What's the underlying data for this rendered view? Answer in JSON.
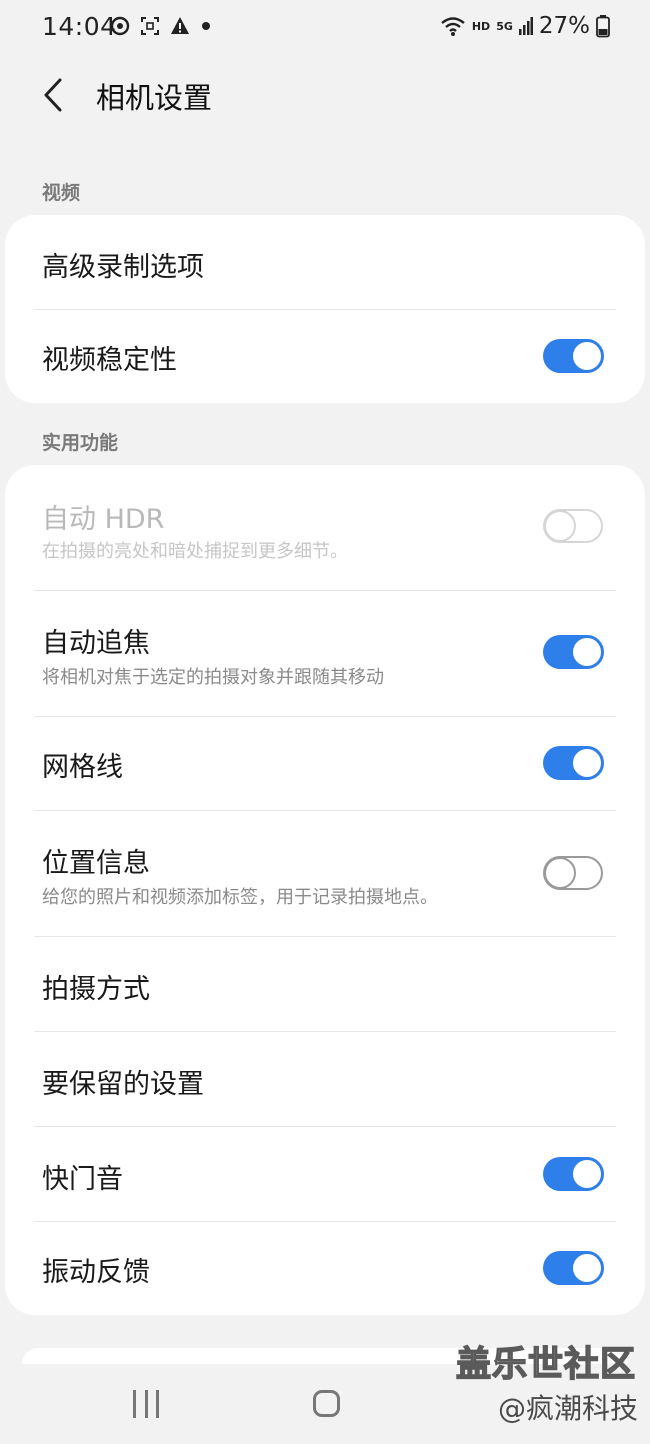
{
  "status_bar": {
    "time": "14:04",
    "hd": "HD",
    "network": "5G",
    "battery": "27%",
    "icons_left": [
      "sync-icon",
      "screenshot-icon",
      "warning-icon",
      "dot-icon"
    ],
    "icons_right": [
      "wifi-icon",
      "signal-icon",
      "battery-icon"
    ]
  },
  "header": {
    "title": "相机设置"
  },
  "sections": {
    "video": {
      "label": "视频",
      "items": {
        "advanced": {
          "title": "高级录制选项"
        },
        "stabilization": {
          "title": "视频稳定性",
          "toggle": "on"
        }
      }
    },
    "utility": {
      "label": "实用功能",
      "items": {
        "auto_hdr": {
          "title": "自动 HDR",
          "subtitle": "在拍摄的亮处和暗处捕捉到更多细节。",
          "toggle": "off",
          "disabled": true
        },
        "tracking_af": {
          "title": "自动追焦",
          "subtitle": "将相机对焦于选定的拍摄对象并跟随其移动",
          "toggle": "on"
        },
        "grid_lines": {
          "title": "网格线",
          "toggle": "on"
        },
        "location_tags": {
          "title": "位置信息",
          "subtitle": "给您的照片和视频添加标签，用于记录拍摄地点。",
          "toggle": "off"
        },
        "shooting_methods": {
          "title": "拍摄方式"
        },
        "settings_to_keep": {
          "title": "要保留的设置"
        },
        "shutter_sound": {
          "title": "快门音",
          "toggle": "on"
        },
        "vibration_feedback": {
          "title": "振动反馈",
          "toggle": "on"
        }
      }
    }
  },
  "watermark": {
    "line1": "盖乐世社区",
    "line2": "@疯潮科技"
  },
  "colors": {
    "accent": "#2f7fea",
    "background": "#f2f2f2",
    "card": "#ffffff"
  }
}
